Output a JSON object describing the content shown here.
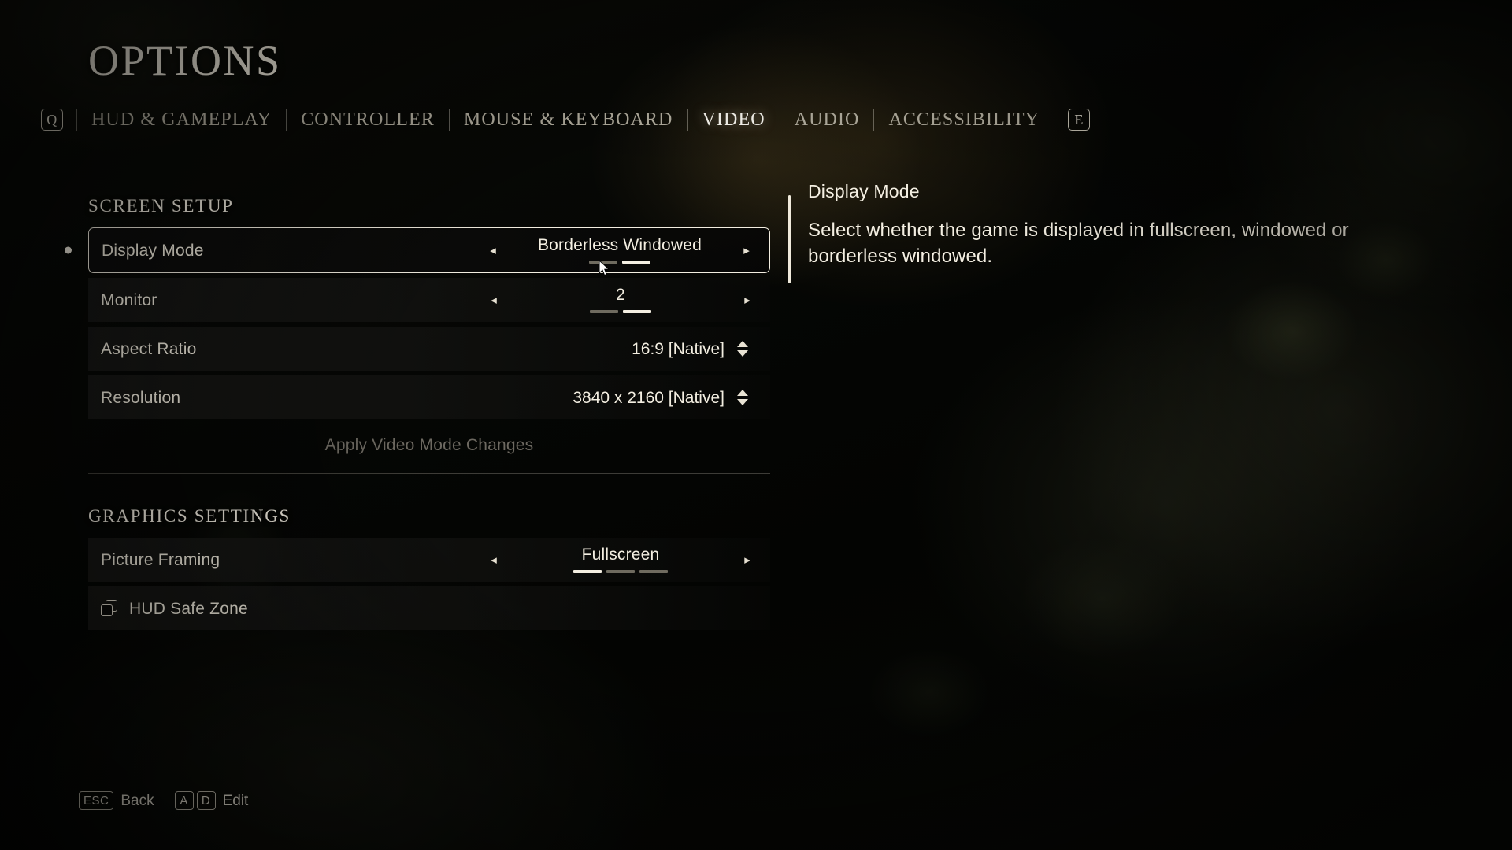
{
  "header": {
    "title": "OPTIONS",
    "prev_key": "Q",
    "next_key": "E",
    "tabs": [
      {
        "label": "HUD & GAMEPLAY",
        "active": false
      },
      {
        "label": "CONTROLLER",
        "active": false
      },
      {
        "label": "MOUSE & KEYBOARD",
        "active": false
      },
      {
        "label": "VIDEO",
        "active": true
      },
      {
        "label": "AUDIO",
        "active": false
      },
      {
        "label": "ACCESSIBILITY",
        "active": false
      }
    ]
  },
  "sections": [
    {
      "label": "SCREEN SETUP",
      "rows": [
        {
          "type": "selector",
          "label": "Display Mode",
          "value": "Borderless Windowed",
          "selected": true,
          "left_arrow": "◂",
          "right_arrow": "▸",
          "segments": [
            false,
            true
          ]
        },
        {
          "type": "selector",
          "label": "Monitor",
          "value": "2",
          "selected": false,
          "left_arrow": "◂",
          "right_arrow": "▸",
          "segments": [
            false,
            true
          ]
        },
        {
          "type": "stepper",
          "label": "Aspect Ratio",
          "value": "16:9 [Native]",
          "selected": false
        },
        {
          "type": "stepper",
          "label": "Resolution",
          "value": "3840 x 2160 [Native]",
          "selected": false
        },
        {
          "type": "action",
          "label": "Apply Video Mode Changes",
          "disabled": true
        }
      ]
    },
    {
      "label": "GRAPHICS SETTINGS",
      "rows": [
        {
          "type": "selector",
          "label": "Picture Framing",
          "value": "Fullscreen",
          "selected": false,
          "left_arrow": "◂",
          "right_arrow": "▸",
          "segments": [
            true,
            false,
            false
          ]
        },
        {
          "type": "submenu",
          "label": "HUD Safe Zone",
          "icon": "copy-icon"
        }
      ]
    }
  ],
  "description": {
    "title": "Display Mode",
    "body": "Select whether the game is displayed in fullscreen, windowed or borderless windowed."
  },
  "footer": {
    "hints": [
      {
        "keys": [
          "ESC"
        ],
        "label": "Back"
      },
      {
        "keys": [
          "A",
          "D"
        ],
        "label": "Edit"
      }
    ]
  },
  "colors": {
    "text_primary": "#f4efe2",
    "text_dim": "#6d6961",
    "accent": "#f2ede0",
    "segment_off": "#6f6b5f"
  }
}
